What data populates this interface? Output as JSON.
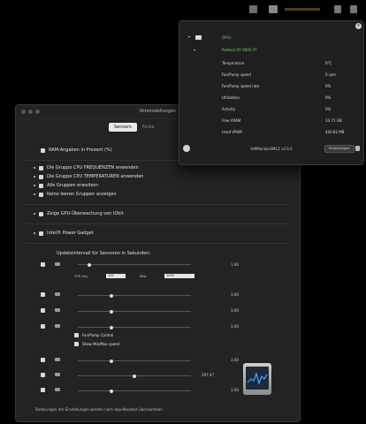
{
  "menubar": {
    "icons": [
      "cpu-monitor-icon",
      "gpu-monitor-icon",
      "sensor-graph-icon",
      "network-icon",
      "battery-icon"
    ]
  },
  "prefs": {
    "title": "Voreinstellungen",
    "tabs": [
      {
        "label": "Sensors",
        "active": true
      },
      {
        "label": "Farbe",
        "active": false
      }
    ],
    "options": [
      {
        "label": "RAM-Angaben in Prozent (%)"
      },
      {
        "label": "Die Gruppe CPU FREQUENZEN anwenden"
      },
      {
        "label": "Die Gruppe CPU TEMPERATUREN anwenden"
      },
      {
        "label": "Alle Gruppen erweitern"
      },
      {
        "label": "Keine leeren Gruppen anzeigen"
      },
      {
        "label": "Zeige GPU-Überwachung von IOkit"
      },
      {
        "label": "Intel® Power Gadget"
      }
    ],
    "update_header": "Updateintervall für Sensoren in Sekunden:",
    "top_label": "TOP (kb)",
    "top_value": "100",
    "min_label": "MHz",
    "min_value": "1000",
    "sliders": [
      {
        "value": "1.00",
        "level": 0.1
      },
      {
        "value": "3.00",
        "level": 0.3
      },
      {
        "value": "3.00",
        "level": 0.3
      },
      {
        "value": "3.00",
        "level": 0.3
      },
      {
        "value": "3.00",
        "level": 0.3
      },
      {
        "value": "297.47",
        "level": 0.5
      },
      {
        "value": "3.00",
        "level": 0.3
      }
    ],
    "subopts": [
      {
        "label": "Fan/Pump Control"
      },
      {
        "label": "Show Min/Max speed"
      }
    ],
    "footer": "Änderungen der Einstellungen werden nach App-Neustart übernommen"
  },
  "popover": {
    "group": "GPUs",
    "device": "Radeon RX 6600 XT",
    "rows": [
      {
        "label": "Temperature",
        "value": "0°C"
      },
      {
        "label": "Fan/Pump speed",
        "value": "0 rpm"
      },
      {
        "label": "Fan/Pump speed rate",
        "value": "0%"
      },
      {
        "label": "Utilization",
        "value": "0%"
      },
      {
        "label": "Activity",
        "value": "0%"
      },
      {
        "label": "Free VRAM",
        "value": "14.71 GB"
      },
      {
        "label": "Used VRAM",
        "value": "440.82 MB"
      }
    ],
    "version": "HWMonitorSMC2 v2.6.0",
    "button": "Einstellungen"
  },
  "colors": {
    "accent_green": "#6bd36b",
    "window_bg": "#232323",
    "popover_bg": "#1f1f1f"
  }
}
